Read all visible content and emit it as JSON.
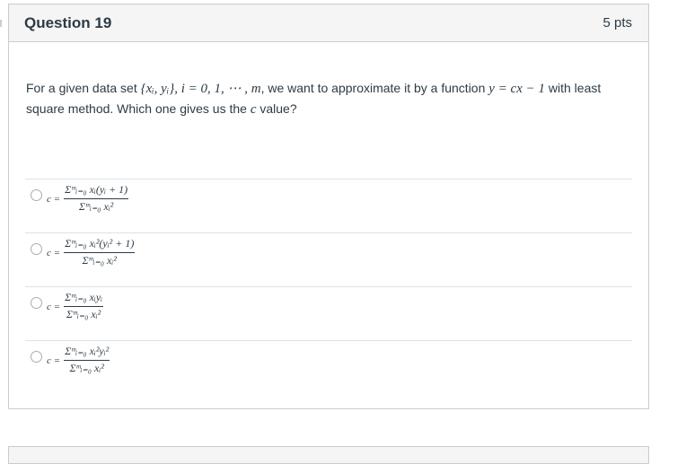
{
  "question": {
    "title": "Question 19",
    "points": "5 pts",
    "text_part1": "For a given data set ",
    "dataset_math": "{xᵢ, yᵢ}, i = 0, 1, ⋯ , m",
    "text_part2": ", we want to approximate it by a function ",
    "function_math": "y = cx − 1",
    "text_part3": " with least square method. Which one gives us the ",
    "c_math": "c",
    "text_part4": " value?"
  },
  "answers": [
    {
      "lhs": "c =",
      "numerator": "Σᵐᵢ₌₀ xᵢ(yᵢ + 1)",
      "denominator": "Σᵐᵢ₌₀ xᵢ²",
      "selected": false
    },
    {
      "lhs": "c =",
      "numerator": "Σᵐᵢ₌₀ xᵢ²(yᵢ² + 1)",
      "denominator": "Σᵐᵢ₌₀ xᵢ²",
      "selected": false
    },
    {
      "lhs": "c =",
      "numerator": "Σᵐᵢ₌₀ xᵢyᵢ",
      "denominator": "Σᵐᵢ₌₀ xᵢ²",
      "selected": false
    },
    {
      "lhs": "c =",
      "numerator": "Σᵐᵢ₌₀ xᵢ²yᵢ²",
      "denominator": "Σᵐᵢ₌₀ xᵢ²",
      "selected": false
    }
  ]
}
